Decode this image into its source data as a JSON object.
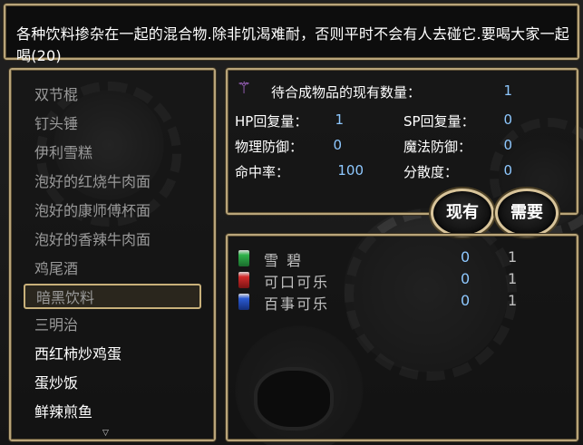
{
  "help": {
    "text": "各种饮料掺杂在一起的混合物.除非饥渴难耐，否则平时不会有人去碰它.要喝大家一起喝(20)"
  },
  "list": {
    "items": [
      {
        "label": "双节棍",
        "enabled": false
      },
      {
        "label": "钉头锤",
        "enabled": false
      },
      {
        "label": "伊利雪糕",
        "enabled": false
      },
      {
        "label": "泡好的红烧牛肉面",
        "enabled": false
      },
      {
        "label": "泡好的康师傅杯面",
        "enabled": false
      },
      {
        "label": "泡好的香辣牛肉面",
        "enabled": false
      },
      {
        "label": "鸡尾酒",
        "enabled": false
      },
      {
        "label": "暗黑饮料",
        "enabled": false,
        "selected": true
      },
      {
        "label": "三明治",
        "enabled": false
      },
      {
        "label": "西红柿炒鸡蛋",
        "enabled": true
      },
      {
        "label": "蛋炒饭",
        "enabled": true
      },
      {
        "label": "鲜辣煎鱼",
        "enabled": true
      }
    ],
    "more_indicator": "▽"
  },
  "status": {
    "header_label": "待合成物品的现有数量：",
    "header_value": "1",
    "hp_label": "HP回复量：",
    "hp_value": "1",
    "sp_label": "SP回复量：",
    "sp_value": "0",
    "pdef_label": "物理防御：",
    "pdef_value": "0",
    "mdef_label": "魔法防御：",
    "mdef_value": "0",
    "hit_label": "命中率：",
    "hit_value": "100",
    "spread_label": "分散度：",
    "spread_value": "0"
  },
  "buttons": {
    "have": "现有",
    "need": "需要"
  },
  "materials": [
    {
      "name": "雪 碧",
      "have": "0",
      "need": "1",
      "color": "#2fb24a"
    },
    {
      "name": "可口可乐",
      "have": "0",
      "need": "1",
      "color": "#d22a2a"
    },
    {
      "name": "百事可乐",
      "have": "0",
      "need": "1",
      "color": "#2a5ad2"
    }
  ],
  "colors": {
    "frame": "#b9a57a",
    "value_blue": "#8ec8ff",
    "disabled_text": "#9a9a9a"
  }
}
